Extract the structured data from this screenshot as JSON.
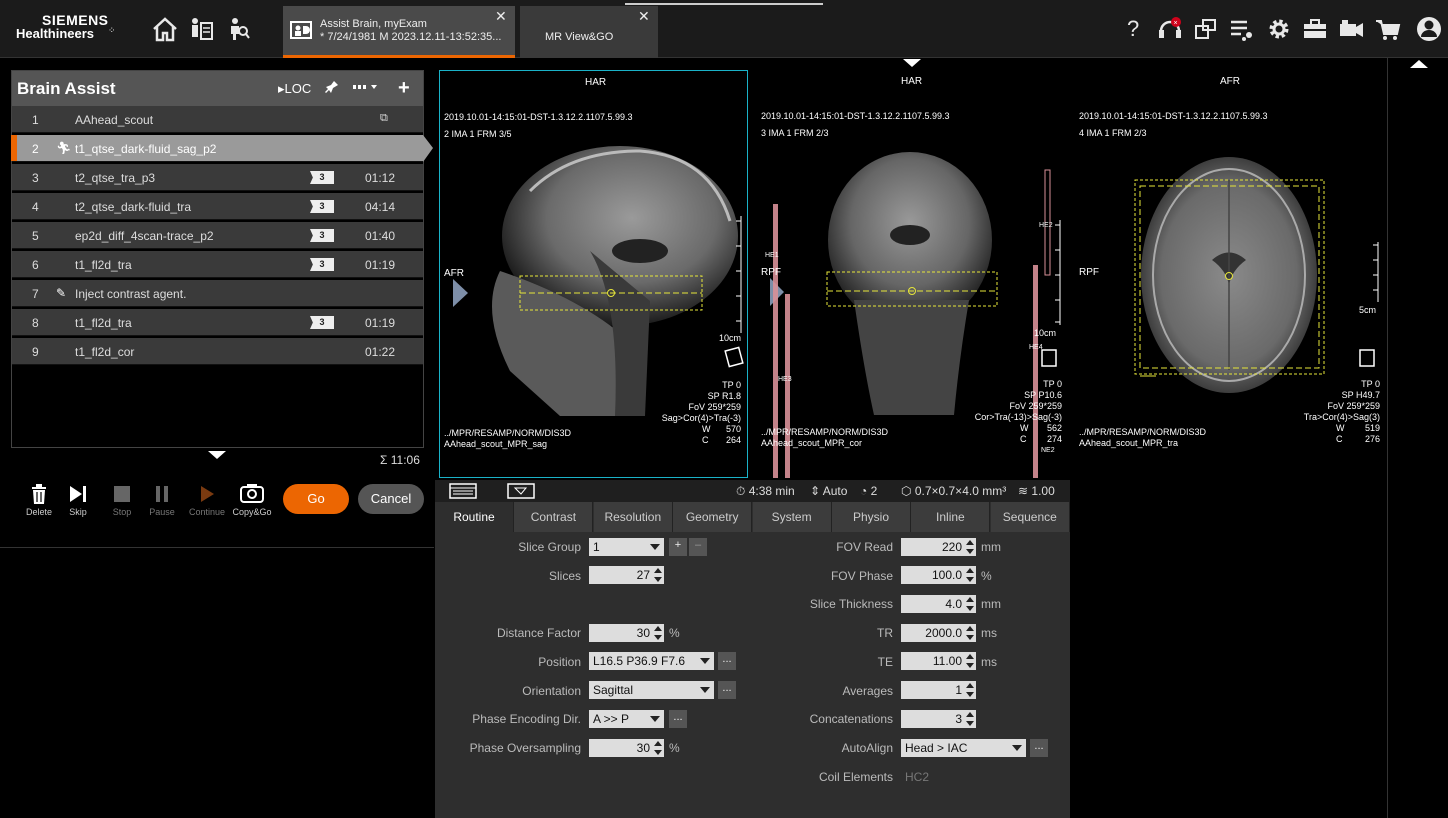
{
  "logo": {
    "line1": "SIEMENS",
    "line2": "Healthineers"
  },
  "tabs": {
    "exam_line1": "Assist Brain, myExam",
    "exam_line2": "* 7/24/1981 M 2023.12.11-13:52:35...",
    "mr_label": "MR View&GO",
    "close_glyph": "✕"
  },
  "top_icons": [
    "home-icon",
    "patient-registration-icon",
    "patient-browser-icon",
    "help-icon",
    "headset-icon",
    "windows-icon",
    "queue-icon",
    "settings-icon",
    "toolbox-icon",
    "camera-icon",
    "cart-icon",
    "user-icon"
  ],
  "protocol": {
    "title": "Brain Assist",
    "loc_label": "LOC",
    "rows": [
      {
        "num": "1",
        "name": "AAhead_scout",
        "badge": "",
        "duration": ""
      },
      {
        "num": "2",
        "name": "t1_qtse_dark-fluid_sag_p2",
        "badge": "",
        "duration": ""
      },
      {
        "num": "3",
        "name": "t2_qtse_tra_p3",
        "badge": "3",
        "duration": "01:12"
      },
      {
        "num": "4",
        "name": "t2_qtse_dark-fluid_tra",
        "badge": "3",
        "duration": "04:14"
      },
      {
        "num": "5",
        "name": "ep2d_diff_4scan-trace_p2",
        "badge": "3",
        "duration": "01:40"
      },
      {
        "num": "6",
        "name": "t1_fl2d_tra",
        "badge": "3",
        "duration": "01:19"
      },
      {
        "num": "7",
        "name": "Inject contrast agent.",
        "badge": "",
        "duration": ""
      },
      {
        "num": "8",
        "name": "t1_fl2d_tra",
        "badge": "3",
        "duration": "01:19"
      },
      {
        "num": "9",
        "name": "t1_fl2d_cor",
        "badge": "",
        "duration": "01:22"
      }
    ],
    "total": "Σ 11:06"
  },
  "controls": {
    "delete": "Delete",
    "skip": "Skip",
    "stop": "Stop",
    "pause": "Pause",
    "continue": "Continue",
    "copygo": "Copy&Go",
    "go": "Go",
    "cancel": "Cancel"
  },
  "viewers": [
    {
      "top": "HAR",
      "left": "AFR",
      "series": "2019.10.01-14:15:01-DST-1.3.12.2.1107.5.99.3",
      "ima": "2 IMA 1 FRM 3/5",
      "scale": "10cm",
      "tp": "TP 0",
      "sp": "SP R1.8",
      "fov": "FoV 259*259",
      "orient": "Sag>Cor(4)>Tra(-3)",
      "w": "W",
      "w_val": "570",
      "c": "C",
      "c_val": "264",
      "path": "../MPR/RESAMP/NORM/DIS3D",
      "name": "AAhead_scout_MPR_sag"
    },
    {
      "top": "HAR",
      "left": "RPF",
      "series": "2019.10.01-14:15:01-DST-1.3.12.2.1107.5.99.3",
      "ima": "3 IMA 1 FRM 2/3",
      "scale": "10cm",
      "tp": "TP 0",
      "sp": "SP P10.6",
      "fov": "FoV 259*259",
      "orient": "Cor>Tra(-13)>Sag(-3)",
      "w": "W",
      "w_val": "562",
      "c": "C",
      "c_val": "274",
      "path": "../MPR/RESAMP/NORM/DIS3D",
      "name": "AAhead_scout_MPR_cor",
      "coils": [
        "HE1",
        "HE2",
        "HE3",
        "HE4",
        "NE2"
      ]
    },
    {
      "top": "AFR",
      "left": "RPF",
      "series": "2019.10.01-14:15:01-DST-1.3.12.2.1107.5.99.3",
      "ima": "4 IMA 1 FRM 2/3",
      "scale": "5cm",
      "tp": "TP 0",
      "sp": "SP H49.7",
      "fov": "FoV 259*259",
      "orient": "Tra>Cor(4)>Sag(3)",
      "w": "W",
      "w_val": "519",
      "c": "C",
      "c_val": "276",
      "path": "../MPR/RESAMP/NORM/DIS3D",
      "name": "AAhead_scout_MPR_tra"
    }
  ],
  "param_toolbar": {
    "time": "4:38 min",
    "auto": "Auto",
    "count": "2",
    "voxel": "0.7×0.7×4.0 mm³",
    "ratio": "1.00"
  },
  "param_tabs": [
    "Routine",
    "Contrast",
    "Resolution",
    "Geometry",
    "System",
    "Physio",
    "Inline",
    "Sequence"
  ],
  "params": {
    "slice_group": {
      "label": "Slice Group",
      "value": "1"
    },
    "slices": {
      "label": "Slices",
      "value": "27"
    },
    "distance_factor": {
      "label": "Distance Factor",
      "value": "30",
      "unit": "%"
    },
    "position": {
      "label": "Position",
      "value": "L16.5 P36.9 F7.6"
    },
    "orientation": {
      "label": "Orientation",
      "value": "Sagittal"
    },
    "phase_enc": {
      "label": "Phase Encoding Dir.",
      "value": "A >> P"
    },
    "phase_os": {
      "label": "Phase Oversampling",
      "value": "30",
      "unit": "%"
    },
    "fov_read": {
      "label": "FOV Read",
      "value": "220",
      "unit": "mm"
    },
    "fov_phase": {
      "label": "FOV Phase",
      "value": "100.0",
      "unit": "%"
    },
    "slice_thickness": {
      "label": "Slice Thickness",
      "value": "4.0",
      "unit": "mm"
    },
    "tr": {
      "label": "TR",
      "value": "2000.0",
      "unit": "ms"
    },
    "te": {
      "label": "TE",
      "value": "11.00",
      "unit": "ms"
    },
    "averages": {
      "label": "Averages",
      "value": "1"
    },
    "concatenations": {
      "label": "Concatenations",
      "value": "3"
    },
    "autoalign": {
      "label": "AutoAlign",
      "value": "Head > IAC"
    },
    "coil_elements": {
      "label": "Coil Elements",
      "value": "HC2"
    },
    "more_btn": "...",
    "plus_btn": "+",
    "minus_btn": "–"
  },
  "colors": {
    "accent": "#ec6602",
    "active_border": "#1ab2c8",
    "plan_box": "#e6e63a"
  }
}
